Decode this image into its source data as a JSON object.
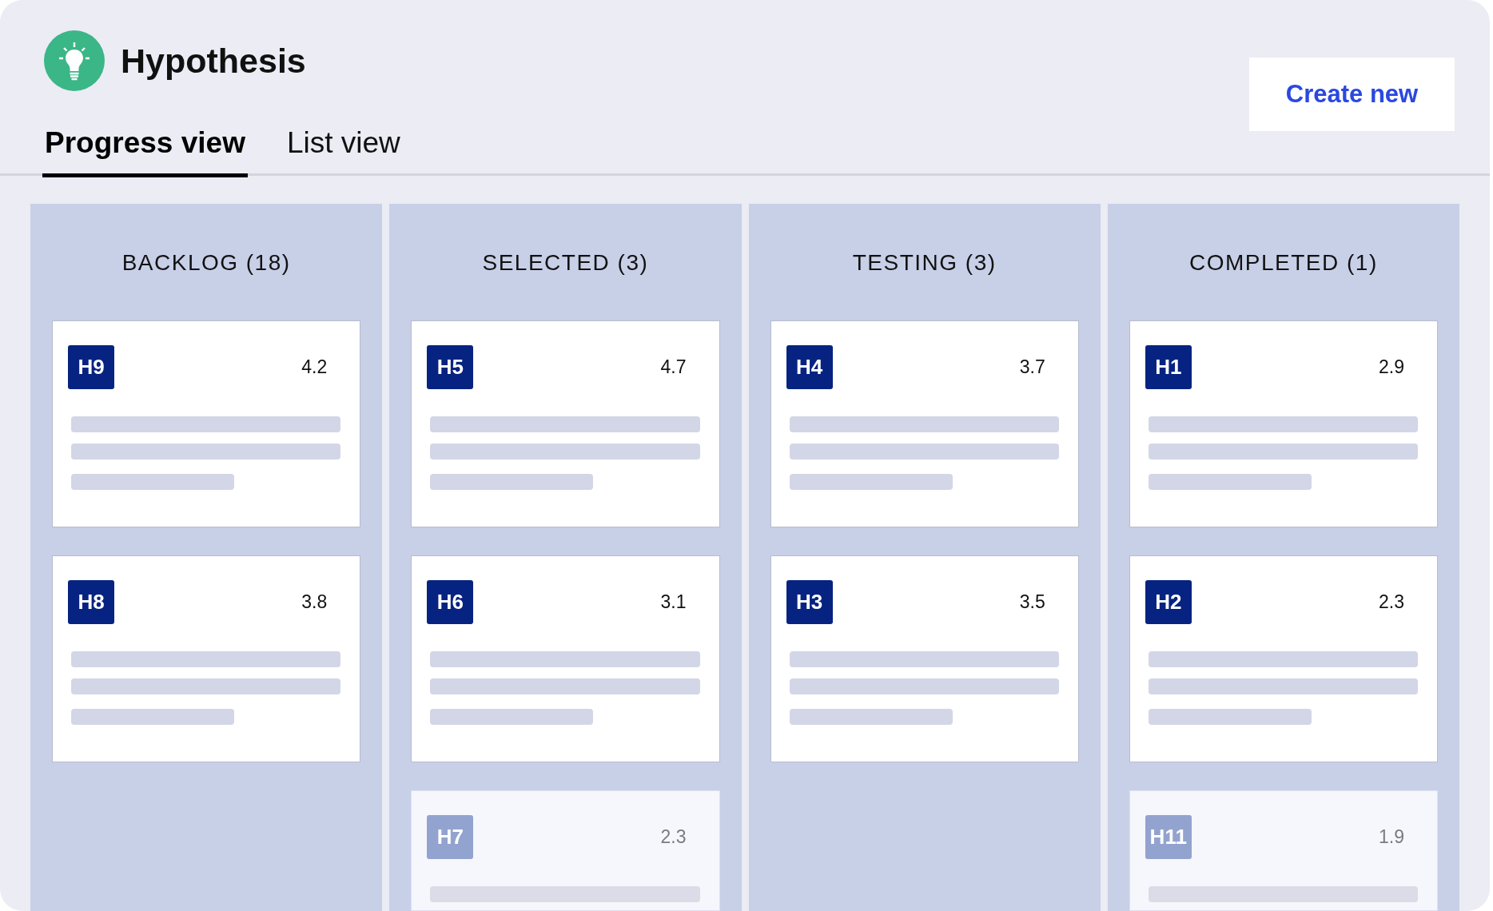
{
  "header": {
    "title": "Hypothesis"
  },
  "tabs": [
    {
      "label": "Progress view",
      "selected": true
    },
    {
      "label": "List view",
      "selected": false
    }
  ],
  "create_button": {
    "label": "Create new"
  },
  "columns": [
    {
      "title": "BACKLOG (18)",
      "cards": [
        {
          "id": "H9",
          "score": "4.2",
          "dimmed": false,
          "text_lines": [
            {
              "kind": "long"
            },
            {
              "kind": "long"
            },
            {
              "kind": "short"
            }
          ]
        },
        {
          "id": "H8",
          "score": "3.8",
          "dimmed": false,
          "text_lines": [
            {
              "kind": "long"
            },
            {
              "kind": "long"
            },
            {
              "kind": "short"
            }
          ]
        }
      ]
    },
    {
      "title": "SELECTED (3)",
      "cards": [
        {
          "id": "H5",
          "score": "4.7",
          "dimmed": false,
          "text_lines": [
            {
              "kind": "long"
            },
            {
              "kind": "long"
            },
            {
              "kind": "short"
            }
          ]
        },
        {
          "id": "H6",
          "score": "3.1",
          "dimmed": false,
          "text_lines": [
            {
              "kind": "long"
            },
            {
              "kind": "long"
            },
            {
              "kind": "short"
            }
          ]
        },
        {
          "id": "H7",
          "score": "2.3",
          "dimmed": true,
          "text_lines": [
            {
              "kind": "long"
            }
          ]
        }
      ]
    },
    {
      "title": "TESTING (3)",
      "cards": [
        {
          "id": "H4",
          "score": "3.7",
          "dimmed": false,
          "text_lines": [
            {
              "kind": "long"
            },
            {
              "kind": "long"
            },
            {
              "kind": "short"
            }
          ]
        },
        {
          "id": "H3",
          "score": "3.5",
          "dimmed": false,
          "text_lines": [
            {
              "kind": "long"
            },
            {
              "kind": "long"
            },
            {
              "kind": "short"
            }
          ]
        }
      ]
    },
    {
      "title": "COMPLETED (1)",
      "cards": [
        {
          "id": "H1",
          "score": "2.9",
          "dimmed": false,
          "text_lines": [
            {
              "kind": "long"
            },
            {
              "kind": "long"
            },
            {
              "kind": "short"
            }
          ]
        },
        {
          "id": "H2",
          "score": "2.3",
          "dimmed": false,
          "text_lines": [
            {
              "kind": "long"
            },
            {
              "kind": "long"
            },
            {
              "kind": "short"
            }
          ]
        },
        {
          "id": "H11",
          "score": "1.9",
          "dimmed": true,
          "text_lines": [
            {
              "kind": "long"
            }
          ]
        }
      ]
    }
  ]
}
